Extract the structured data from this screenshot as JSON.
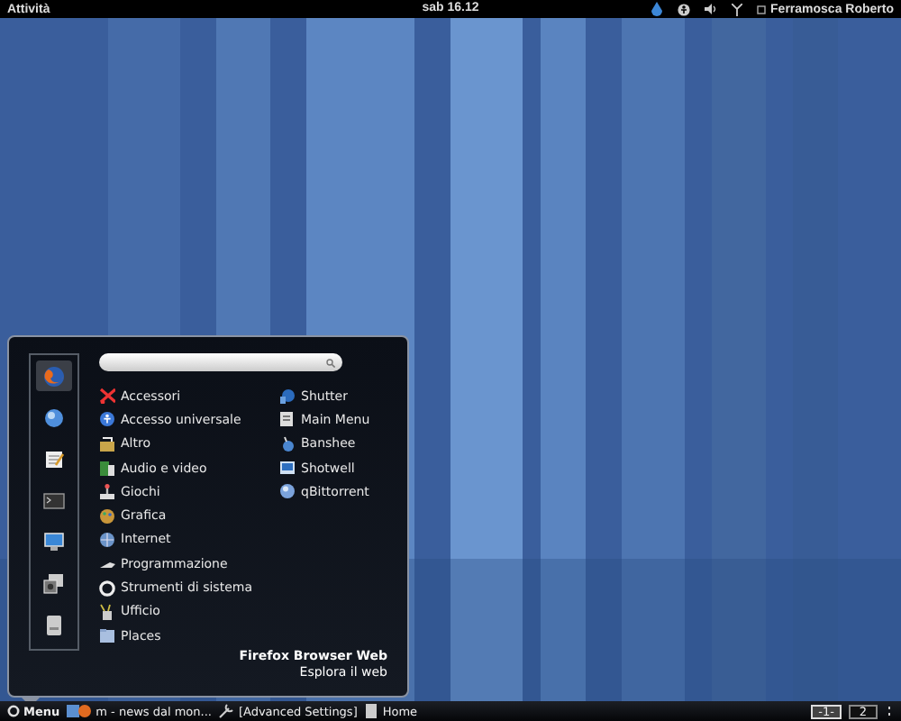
{
  "top_bar": {
    "activities": "Attività",
    "clock": "sab 16.12",
    "user": "Ferramosca Roberto"
  },
  "menu": {
    "favorites": [
      {
        "selected": true
      },
      {
        "selected": false
      },
      {
        "selected": false
      },
      {
        "selected": false
      },
      {
        "selected": false
      },
      {
        "selected": false
      },
      {
        "selected": false
      }
    ],
    "categories": [
      "Accessori",
      "Accesso universale",
      "Altro",
      "Audio e video",
      "Giochi",
      "Grafica",
      "Internet",
      "Programmazione",
      "Strumenti di sistema",
      "Ufficio",
      "Places"
    ],
    "applications": [
      "Shutter",
      "Main Menu",
      "Banshee",
      "Shotwell",
      "qBittorrent"
    ],
    "description": {
      "title": "Firefox Browser Web",
      "subtitle": "Esplora il web"
    }
  },
  "bottom_bar": {
    "menu_button": "Menu",
    "tasks": [
      "m - news dal mon...",
      "[Advanced Settings]",
      "Home"
    ],
    "workspaces": [
      {
        "label": "-1-",
        "selected": true
      },
      {
        "label": "2",
        "selected": false
      }
    ]
  }
}
